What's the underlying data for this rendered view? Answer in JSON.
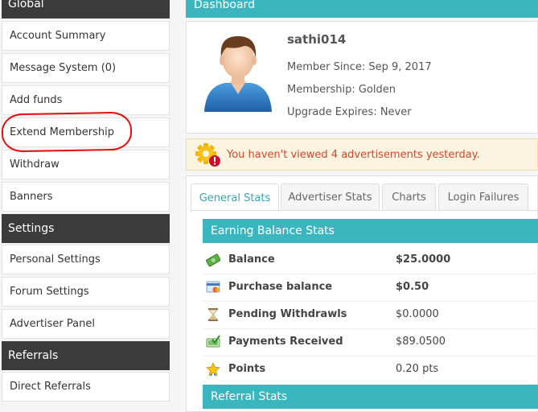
{
  "sidebar": {
    "sections": [
      {
        "title": "Global"
      },
      {
        "title": "Settings"
      },
      {
        "title": "Referrals"
      }
    ],
    "items": [
      {
        "label": "Account Summary"
      },
      {
        "label": "Message System (0)"
      },
      {
        "label": "Add funds"
      },
      {
        "label": "Extend Membership"
      },
      {
        "label": "Withdraw"
      },
      {
        "label": "Banners"
      },
      {
        "label": "Personal Settings"
      },
      {
        "label": "Forum Settings"
      },
      {
        "label": "Advertiser Panel"
      },
      {
        "label": "Direct Referrals"
      }
    ]
  },
  "dashboard": {
    "title": "Dashboard",
    "profile": {
      "username": "sathi014",
      "member_since": "Member Since: Sep 9, 2017",
      "membership": "Membership: Golden",
      "upgrade_expires": "Upgrade Expires: Never"
    },
    "alert": "You haven't viewed 4 advertisements yesterday.",
    "tabs": [
      {
        "label": "General Stats"
      },
      {
        "label": "Advertiser Stats"
      },
      {
        "label": "Charts"
      },
      {
        "label": "Login Failures"
      }
    ],
    "earning_title": "Earning Balance Stats",
    "stats": [
      {
        "label": "Balance",
        "value": "$25.0000",
        "icon": "money-icon"
      },
      {
        "label": "Purchase balance",
        "value": "$0.50",
        "icon": "card-icon"
      },
      {
        "label": "Pending Withdrawls",
        "value": "$0.0000",
        "icon": "hourglass-icon"
      },
      {
        "label": "Payments Received",
        "value": "$89.0500",
        "icon": "check-money-icon"
      },
      {
        "label": "Points",
        "value": "0.20 pts",
        "icon": "star-icon"
      }
    ],
    "referral_title": "Referral Stats"
  },
  "colors": {
    "accent": "#3bb6bf",
    "dark": "#3b3b3b",
    "alert_text": "#d0482c",
    "annotation": "#e01010"
  }
}
